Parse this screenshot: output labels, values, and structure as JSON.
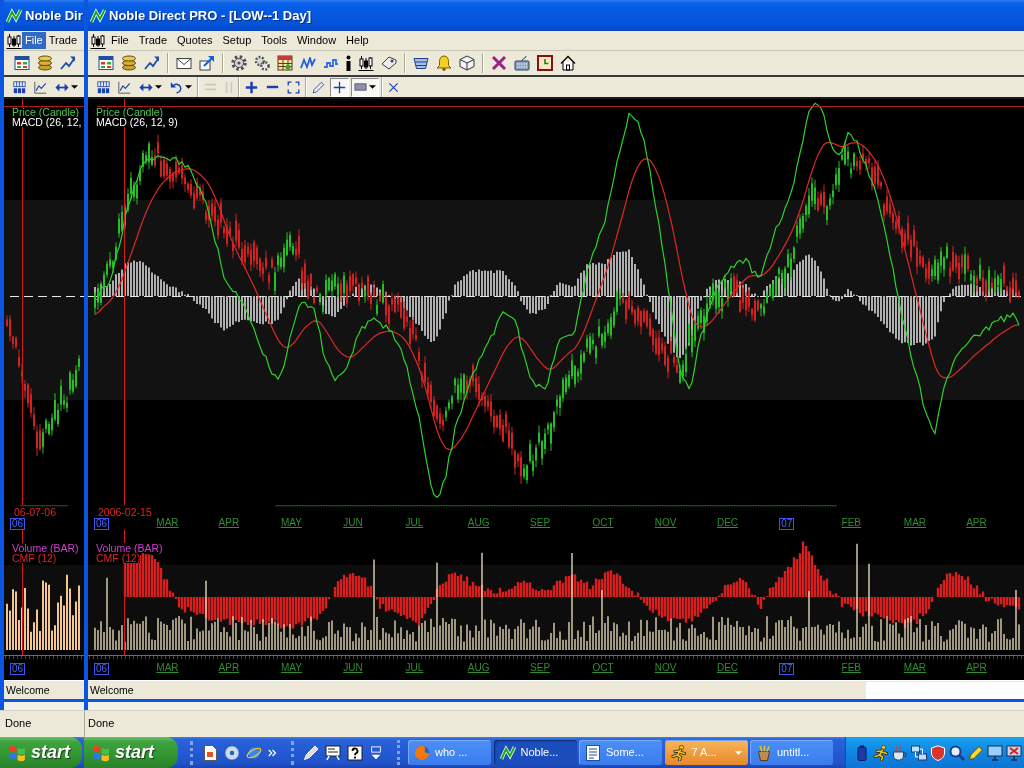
{
  "back_window": {
    "title": "Noble Dir",
    "menu": [
      {
        "label": "File",
        "selected": true
      },
      {
        "label": "Trade",
        "selected": false
      }
    ],
    "tool_groups": [
      [
        {
          "kind": "style",
          "pressed": false,
          "disabled": false,
          "dropdown": false
        },
        {
          "kind": "line",
          "pressed": false,
          "disabled": false,
          "dropdown": false
        },
        {
          "kind": "pan",
          "pressed": false,
          "disabled": false,
          "dropdown": true
        }
      ]
    ],
    "price_pane": {
      "series": [
        {
          "label": "Price (Candle)",
          "kind": "price"
        },
        {
          "label": "MACD (26, 12,",
          "kind": "macd"
        }
      ]
    },
    "price_axis": {
      "cursor_date": "06-07-06",
      "labels": [
        {
          "label": "06",
          "kind": "year"
        }
      ]
    },
    "volume_pane": {
      "series": [
        {
          "label": "Volume (BAR)",
          "kind": "volume"
        },
        {
          "label": "CMF (12)",
          "kind": "cmf"
        }
      ]
    },
    "volume_axis": {
      "labels": [
        {
          "label": "06",
          "kind": "year"
        }
      ]
    },
    "status": "Welcome",
    "browser_status": "Done"
  },
  "front_window": {
    "title": "Noble Direct PRO - [LOW--1 Day]",
    "menu": [
      {
        "label": "File",
        "selected": false
      },
      {
        "label": "Trade",
        "selected": false
      },
      {
        "label": "Quotes",
        "selected": false
      },
      {
        "label": "Setup",
        "selected": false
      },
      {
        "label": "Tools",
        "selected": false
      },
      {
        "label": "Window",
        "selected": false
      },
      {
        "label": "Help",
        "selected": false
      }
    ],
    "tool_groups": [
      [
        {
          "kind": "style",
          "pressed": false,
          "disabled": false,
          "dropdown": false
        },
        {
          "kind": "line",
          "pressed": false,
          "disabled": false,
          "dropdown": false
        },
        {
          "kind": "pan",
          "pressed": false,
          "disabled": false,
          "dropdown": true
        },
        {
          "kind": "undo",
          "pressed": false,
          "disabled": false,
          "dropdown": true
        }
      ],
      [
        {
          "kind": "equal",
          "pressed": false,
          "disabled": true,
          "dropdown": false
        },
        {
          "kind": "pause",
          "pressed": false,
          "disabled": true,
          "dropdown": false
        }
      ],
      [
        {
          "kind": "zoomin",
          "pressed": false,
          "disabled": false,
          "dropdown": false
        },
        {
          "kind": "zoomout",
          "pressed": false,
          "disabled": false,
          "dropdown": false
        },
        {
          "kind": "fit",
          "pressed": false,
          "disabled": false,
          "dropdown": false
        }
      ],
      [
        {
          "kind": "draw",
          "pressed": false,
          "disabled": false,
          "dropdown": false
        },
        {
          "kind": "cross",
          "pressed": true,
          "disabled": false,
          "dropdown": false
        },
        {
          "kind": "band",
          "pressed": true,
          "disabled": false,
          "dropdown": true
        }
      ],
      [
        {
          "kind": "close",
          "pressed": false,
          "disabled": false,
          "dropdown": false
        }
      ]
    ],
    "price_pane": {
      "series": [
        {
          "label": "Price (Candle)",
          "kind": "price"
        },
        {
          "label": "MACD (26, 12, 9)",
          "kind": "macd"
        }
      ]
    },
    "price_axis": {
      "cursor_date": "2006-02-15",
      "labels": [
        {
          "label": "06",
          "kind": "year"
        },
        {
          "label": "MAR",
          "kind": "month"
        },
        {
          "label": "APR",
          "kind": "month"
        },
        {
          "label": "MAY",
          "kind": "month"
        },
        {
          "label": "JUN",
          "kind": "month"
        },
        {
          "label": "JUL",
          "kind": "month"
        },
        {
          "label": "AUG",
          "kind": "month"
        },
        {
          "label": "SEP",
          "kind": "month"
        },
        {
          "label": "OCT",
          "kind": "month"
        },
        {
          "label": "NOV",
          "kind": "month"
        },
        {
          "label": "DEC",
          "kind": "month"
        },
        {
          "label": "07",
          "kind": "year"
        },
        {
          "label": "FEB",
          "kind": "month"
        },
        {
          "label": "MAR",
          "kind": "month"
        },
        {
          "label": "APR",
          "kind": "month"
        }
      ]
    },
    "volume_pane": {
      "series": [
        {
          "label": "Volume (BAR)",
          "kind": "volume"
        },
        {
          "label": "CMF (12)",
          "kind": "cmf"
        }
      ]
    },
    "volume_axis": {
      "labels": [
        {
          "label": "06",
          "kind": "year"
        },
        {
          "label": "MAR",
          "kind": "month"
        },
        {
          "label": "APR",
          "kind": "month"
        },
        {
          "label": "MAY",
          "kind": "month"
        },
        {
          "label": "JUN",
          "kind": "month"
        },
        {
          "label": "JUL",
          "kind": "month"
        },
        {
          "label": "AUG",
          "kind": "month"
        },
        {
          "label": "SEP",
          "kind": "month"
        },
        {
          "label": "OCT",
          "kind": "month"
        },
        {
          "label": "NOV",
          "kind": "month"
        },
        {
          "label": "DEC",
          "kind": "month"
        },
        {
          "label": "07",
          "kind": "year"
        },
        {
          "label": "FEB",
          "kind": "month"
        },
        {
          "label": "MAR",
          "kind": "month"
        },
        {
          "label": "APR",
          "kind": "month"
        }
      ]
    },
    "status": "Welcome",
    "browser_status": "Done"
  },
  "taskbar": {
    "start_buttons": [
      "start",
      "start"
    ],
    "tasks": [
      {
        "label": "who ...",
        "kind": "window",
        "selected": false,
        "flashing": false
      },
      {
        "label": "Noble...",
        "kind": "window",
        "selected": true,
        "flashing": false
      },
      {
        "label": "Some...",
        "kind": "window",
        "selected": false,
        "flashing": false
      },
      {
        "label": "7 A...",
        "kind": "group",
        "selected": false,
        "flashing": true
      },
      {
        "label": "untitl...",
        "kind": "window",
        "selected": false,
        "flashing": false
      }
    ]
  }
}
